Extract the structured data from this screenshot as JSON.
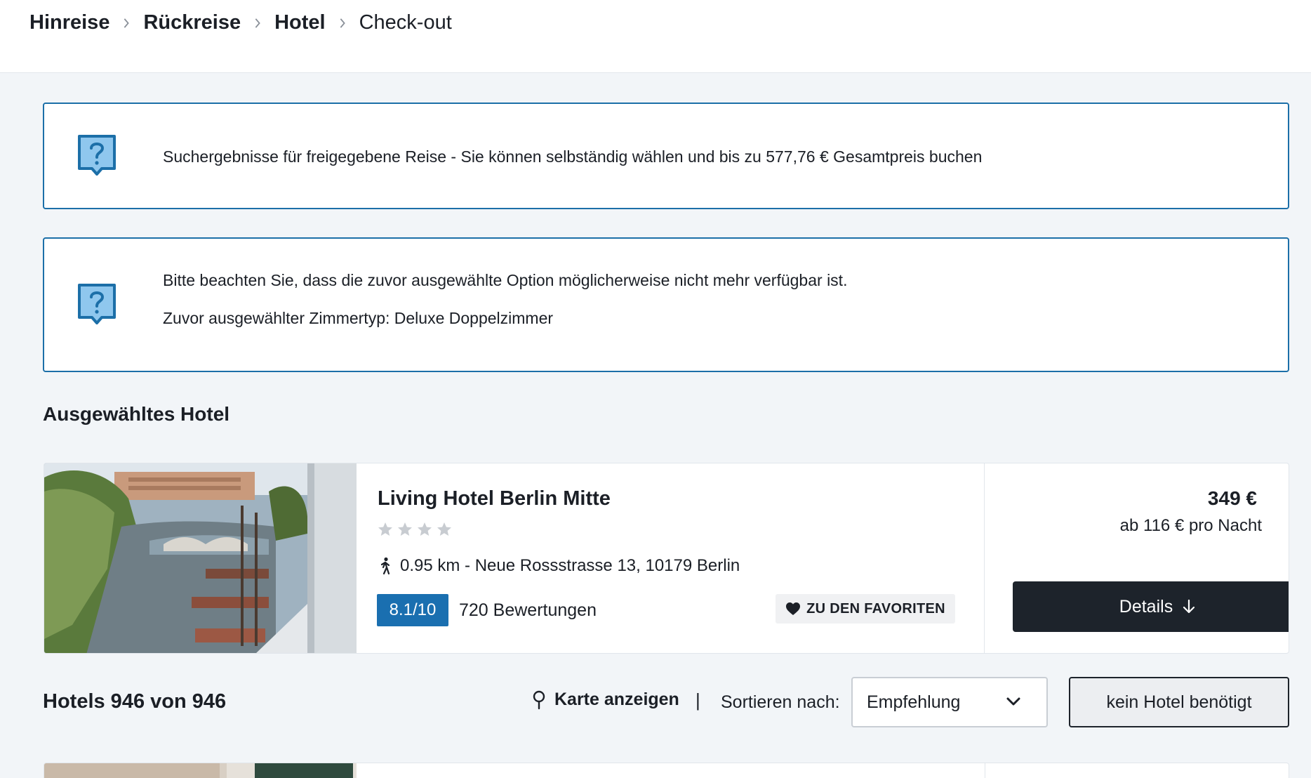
{
  "breadcrumb": {
    "items": [
      {
        "label": "Hinreise"
      },
      {
        "label": "Rückreise"
      },
      {
        "label": "Hotel"
      },
      {
        "label": "Check-out"
      }
    ]
  },
  "info_boxes": {
    "search_notice": "Suchergebnisse für freigegebene Reise - Sie können selbständig wählen und bis zu 577,76 € Gesamtpreis buchen",
    "availability_notice": "Bitte beachten Sie, dass die zuvor ausgewählte Option möglicherweise nicht mehr verfügbar ist.",
    "room_type_notice": "Zuvor ausgewählter Zimmertyp: Deluxe Doppelzimmer"
  },
  "selected_section": {
    "title": "Ausgewähltes Hotel"
  },
  "hotel": {
    "name": "Living Hotel Berlin Mitte",
    "stars": 4,
    "distance": "0.95 km",
    "address_sep": " - ",
    "address": "Neue Rossstrasse 13, 10179 Berlin",
    "rating": "8.1/10",
    "reviews": "720 Bewertungen",
    "favorite_label": "ZU DEN FAVORITEN",
    "price": "349 €",
    "per_night": "ab 116 € pro Nacht",
    "details_label": "Details"
  },
  "results_toolbar": {
    "count": "Hotels 946 von 946",
    "map_label": "Karte anzeigen",
    "separator": "|",
    "sort_label": "Sortieren nach:",
    "sort_value": "Empfehlung",
    "no_hotel_label": "kein Hotel benötigt"
  },
  "colors": {
    "accent_blue": "#1c6fa8",
    "rating_blue": "#1a6fb0",
    "dark_button": "#1d232b",
    "page_bg": "#f2f5f8"
  },
  "icons": {
    "info": "question-bubble-icon",
    "walk": "walking-person-icon",
    "heart": "heart-icon",
    "arrow": "arrow-down-icon",
    "map": "map-pin-icon",
    "chevron": "chevron-down-icon",
    "crumb_sep": "chevron-right-icon"
  }
}
